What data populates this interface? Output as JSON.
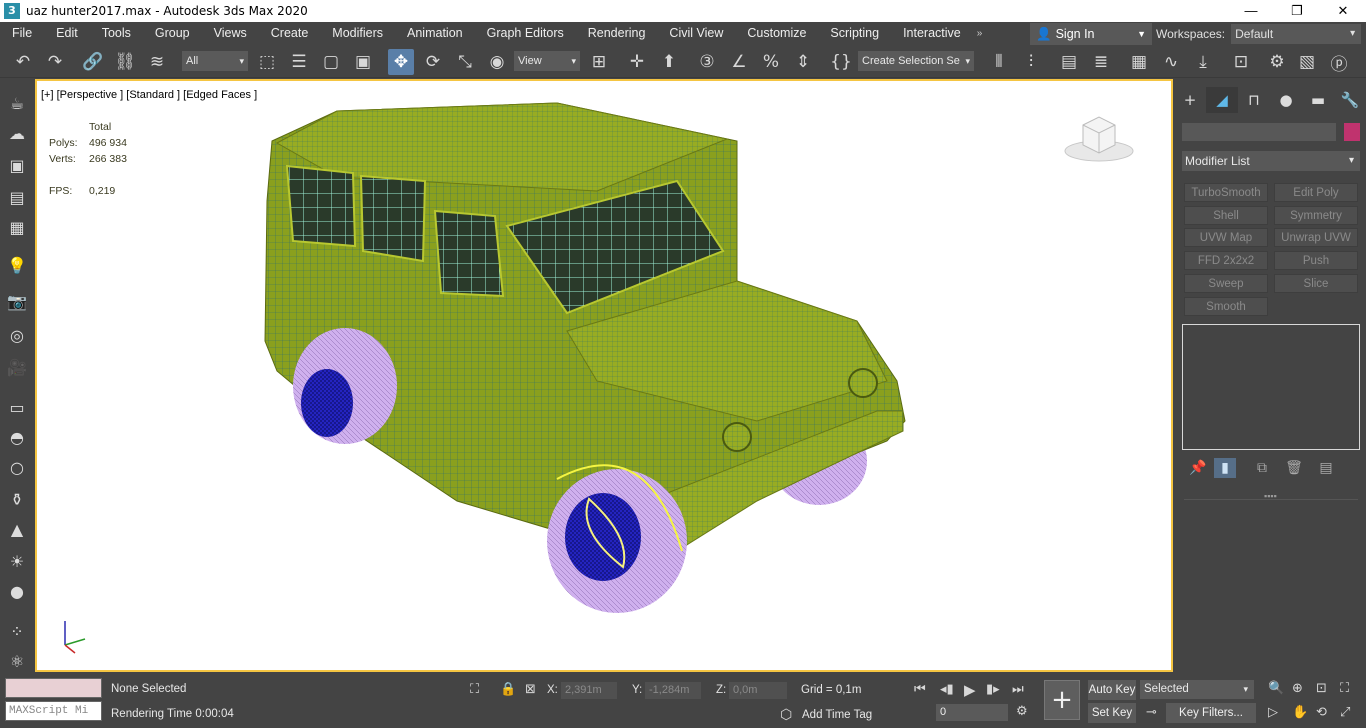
{
  "window": {
    "title": "uaz hunter2017.max - Autodesk 3ds Max 2020",
    "app_icon": "3",
    "minimize": "—",
    "restore": "❐",
    "close": "✕"
  },
  "menu": [
    "File",
    "Edit",
    "Tools",
    "Group",
    "Views",
    "Create",
    "Modifiers",
    "Animation",
    "Graph Editors",
    "Rendering",
    "Civil View",
    "Customize",
    "Scripting",
    "Interactive"
  ],
  "menu_more": "»",
  "signin": {
    "label": "Sign In"
  },
  "workspaces": {
    "label": "Workspaces:",
    "value": "Default"
  },
  "toolbar": {
    "selection_filter": "All",
    "reference_coord": "View",
    "named_selection": "Create Selection Se"
  },
  "viewport": {
    "label": "[+] [Perspective ] [Standard ] [Edged Faces ]",
    "stats": {
      "header": "Total",
      "polys_label": "Polys:",
      "polys_value": "496 934",
      "verts_label": "Verts:",
      "verts_value": "266 383",
      "fps_label": "FPS:",
      "fps_value": "0,219"
    }
  },
  "command_panel": {
    "modifier_list": "Modifier List",
    "modifier_buttons": [
      "TurboSmooth",
      "Edit Poly",
      "Shell",
      "Symmetry",
      "UVW Map",
      "Unwrap UVW",
      "FFD 2x2x2",
      "Push",
      "Sweep",
      "Slice",
      "Smooth"
    ],
    "swatch_color": "#c0336e"
  },
  "status": {
    "maxscript_placeholder": "MAXScript Mi",
    "selection": "None Selected",
    "render_time": "Rendering Time  0:00:04",
    "x_label": "X:",
    "x_value": "2,391m",
    "y_label": "Y:",
    "y_value": "-1,284m",
    "z_label": "Z:",
    "z_value": "0,0m",
    "grid": "Grid = 0,1m",
    "add_time_tag": "Add Time Tag",
    "auto_key": "Auto Key",
    "set_key": "Set Key",
    "key_mode": "Selected",
    "frame": "0",
    "key_filters": "Key Filters..."
  },
  "colors": {
    "accent_viewport_border": "#f5c542",
    "mesh_body": "#8a9e1e",
    "tire": "#c9a6e8",
    "rim": "#2a2ac8"
  }
}
